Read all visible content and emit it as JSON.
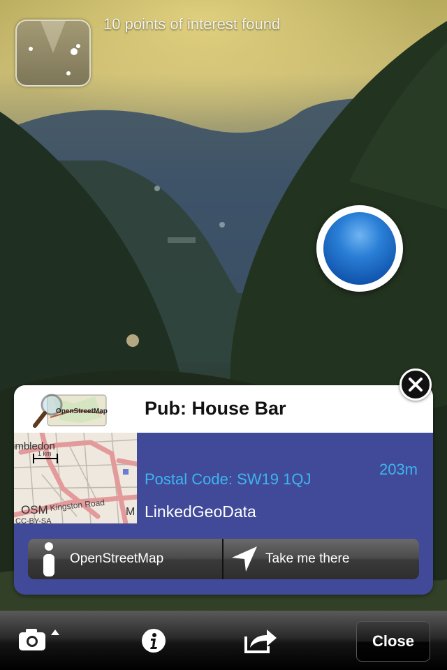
{
  "overlay": {
    "poi_count_text": "10 points of interest found"
  },
  "card": {
    "title": "Pub: House Bar",
    "postal_code": "Postal Code: SW19 1QJ",
    "distance": "203m",
    "source": "LinkedGeoData",
    "logo_text": "OpenStreetMap",
    "map": {
      "place_label": "imbledon",
      "scale_label": "1 km",
      "osm_label": "OSM",
      "license_label": "CC-BY-SA",
      "road_label": "Kingston Road",
      "edge_label": "M"
    },
    "buttons": {
      "osm_label": "OpenStreetMap",
      "navigate_label": "Take me there"
    }
  },
  "toolbar": {
    "close_label": "Close"
  },
  "colors": {
    "card_blue": "#414a98",
    "link_cyan": "#3db5ef",
    "marker_blue": "#2a7fd6"
  },
  "icons": {
    "camera": "camera-icon",
    "info": "info-icon",
    "share": "share-icon",
    "close": "close-icon",
    "navigate": "location-arrow-icon",
    "info_button": "info-i-icon"
  }
}
